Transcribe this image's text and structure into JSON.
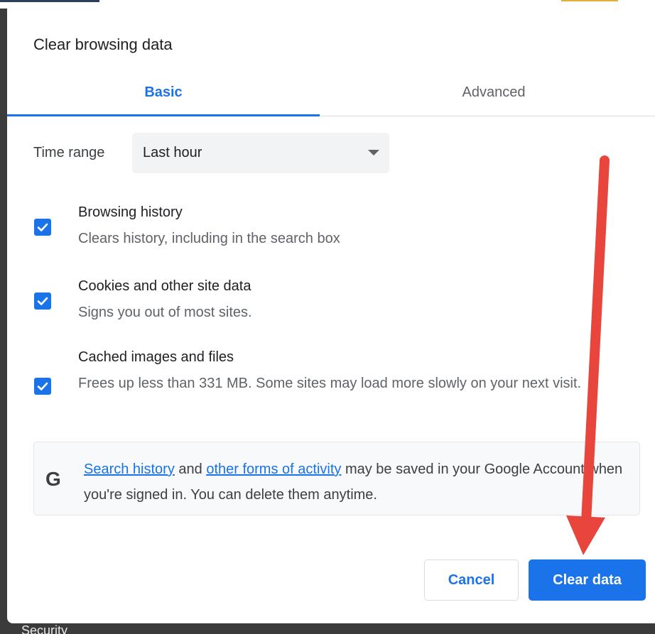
{
  "dialog": {
    "title": "Clear browsing data"
  },
  "tabs": [
    {
      "label": "Basic",
      "active": true
    },
    {
      "label": "Advanced",
      "active": false
    }
  ],
  "time_range": {
    "label": "Time range",
    "selected": "Last hour"
  },
  "options": [
    {
      "title": "Browsing history",
      "description": "Clears history, including in the search box",
      "checked": true
    },
    {
      "title": "Cookies and other site data",
      "description": "Signs you out of most sites.",
      "checked": true
    },
    {
      "title": "Cached images and files",
      "description": "Frees up less than 331 MB. Some sites may load more slowly on your next visit.",
      "checked": true
    }
  ],
  "info": {
    "icon": "google-g-icon",
    "link1": "Search history",
    "text1": " and ",
    "link2": "other forms of activity",
    "text2": " may be saved in your Google Account when you're signed in. You can delete them anytime."
  },
  "buttons": {
    "cancel": "Cancel",
    "clear": "Clear data"
  },
  "background": {
    "under_text": "Security"
  },
  "colors": {
    "accent": "#1a73e8",
    "arrow": "#e8453c"
  }
}
